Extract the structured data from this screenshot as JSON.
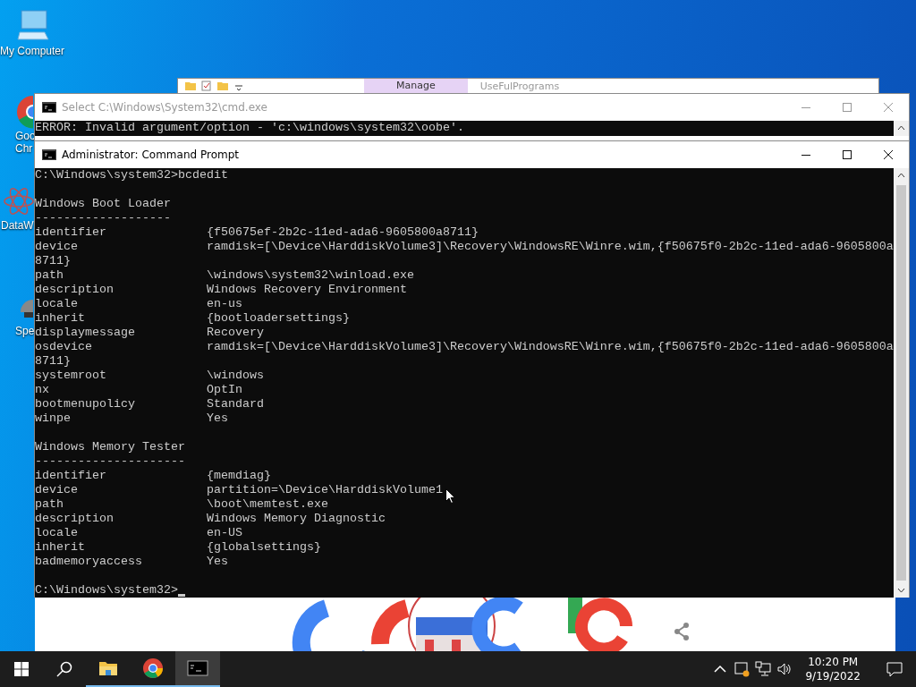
{
  "desktop": {
    "icons": [
      {
        "kind": "computer",
        "label_lines": [
          "My Computer"
        ]
      },
      {
        "kind": "chrome",
        "label_lines": [
          "Goo",
          "Chr"
        ]
      },
      {
        "kind": "atom",
        "label_lines": [
          "DataW"
        ]
      },
      {
        "kind": "tool",
        "label_lines": [
          "Spe"
        ]
      }
    ]
  },
  "explorer_window": {
    "tab": "Manage",
    "title": "UseFulPrograms"
  },
  "cmd_window": {
    "title": "Select C:\\Windows\\System32\\cmd.exe",
    "lines": [
      "ERROR: Invalid argument/option - 'c:\\windows\\system32\\oobe'."
    ]
  },
  "admin_window": {
    "title": "Administrator: Command Prompt",
    "blocks": [
      {
        "lines": [
          {
            "kind": "command",
            "text": "C:\\Windows\\system32>bcdedit"
          }
        ]
      },
      {
        "lines": [
          {
            "kind": "heading",
            "text": "Windows Boot Loader"
          },
          {
            "kind": "rule",
            "text": "-------------------"
          },
          {
            "kind": "field",
            "key": "identifier",
            "value": "{f50675ef-2b2c-11ed-ada6-9605800a8711}"
          },
          {
            "kind": "field",
            "key": "device",
            "value": "ramdisk=[\\Device\\HarddiskVolume3]\\Recovery\\WindowsRE\\Winre.wim,{f50675f0-2b2c-11ed-ada6-9605800a"
          },
          {
            "kind": "wrap",
            "text": "8711}"
          },
          {
            "kind": "field",
            "key": "path",
            "value": "\\windows\\system32\\winload.exe"
          },
          {
            "kind": "field",
            "key": "description",
            "value": "Windows Recovery Environment"
          },
          {
            "kind": "field",
            "key": "locale",
            "value": "en-us"
          },
          {
            "kind": "field",
            "key": "inherit",
            "value": "{bootloadersettings}"
          },
          {
            "kind": "field",
            "key": "displaymessage",
            "value": "Recovery"
          },
          {
            "kind": "field",
            "key": "osdevice",
            "value": "ramdisk=[\\Device\\HarddiskVolume3]\\Recovery\\WindowsRE\\Winre.wim,{f50675f0-2b2c-11ed-ada6-9605800a"
          },
          {
            "kind": "wrap",
            "text": "8711}"
          },
          {
            "kind": "field",
            "key": "systemroot",
            "value": "\\windows"
          },
          {
            "kind": "field",
            "key": "nx",
            "value": "OptIn"
          },
          {
            "kind": "field",
            "key": "bootmenupolicy",
            "value": "Standard"
          },
          {
            "kind": "field",
            "key": "winpe",
            "value": "Yes"
          }
        ]
      },
      {
        "lines": [
          {
            "kind": "heading",
            "text": "Windows Memory Tester"
          },
          {
            "kind": "rule",
            "text": "---------------------"
          },
          {
            "kind": "field",
            "key": "identifier",
            "value": "{memdiag}"
          },
          {
            "kind": "field",
            "key": "device",
            "value": "partition=\\Device\\HarddiskVolume1"
          },
          {
            "kind": "field",
            "key": "path",
            "value": "\\boot\\memtest.exe"
          },
          {
            "kind": "field",
            "key": "description",
            "value": "Windows Memory Diagnostic"
          },
          {
            "kind": "field",
            "key": "locale",
            "value": "en-US"
          },
          {
            "kind": "field",
            "key": "inherit",
            "value": "{globalsettings}"
          },
          {
            "kind": "field",
            "key": "badmemoryaccess",
            "value": "Yes"
          }
        ]
      },
      {
        "lines": [
          {
            "kind": "command",
            "text": "C:\\Windows\\system32>",
            "cursor": true
          }
        ]
      }
    ]
  },
  "taskbar": {
    "apps": [
      {
        "kind": "explorer",
        "selected": false
      },
      {
        "kind": "chrome",
        "selected": false
      },
      {
        "kind": "console",
        "selected": true
      }
    ],
    "time": "10:20 PM",
    "date": "9/19/2022"
  }
}
